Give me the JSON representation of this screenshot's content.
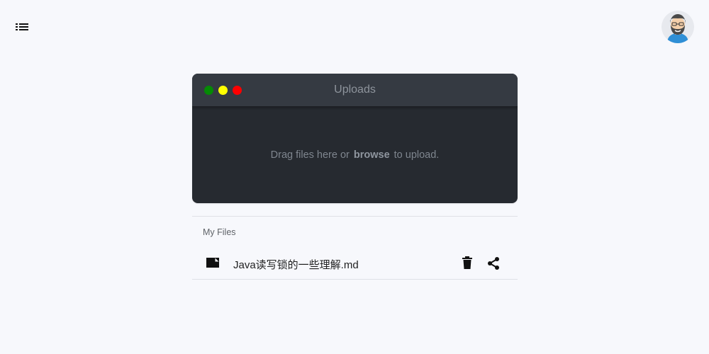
{
  "header": {
    "menu_icon": "list-icon",
    "avatar_icon": "bearded-man-avatar"
  },
  "uploader": {
    "window_title": "Uploads",
    "controls": [
      {
        "name": "green",
        "color": "#058a05"
      },
      {
        "name": "yellow",
        "color": "#ffff00"
      },
      {
        "name": "red",
        "color": "#ff0000"
      }
    ],
    "drop_text_before": "Drag files here or",
    "browse_label": "browse",
    "drop_text_after": "to upload."
  },
  "files": {
    "section_label": "My Files",
    "items": [
      {
        "name": "Java读写锁的一些理解.md",
        "file_icon": "folder-icon",
        "delete_icon": "trash-icon",
        "share_icon": "share-icon"
      }
    ]
  },
  "colors": {
    "background": "#f7f8fc",
    "window_body": "#262a30",
    "window_titlebar": "#353a42"
  }
}
